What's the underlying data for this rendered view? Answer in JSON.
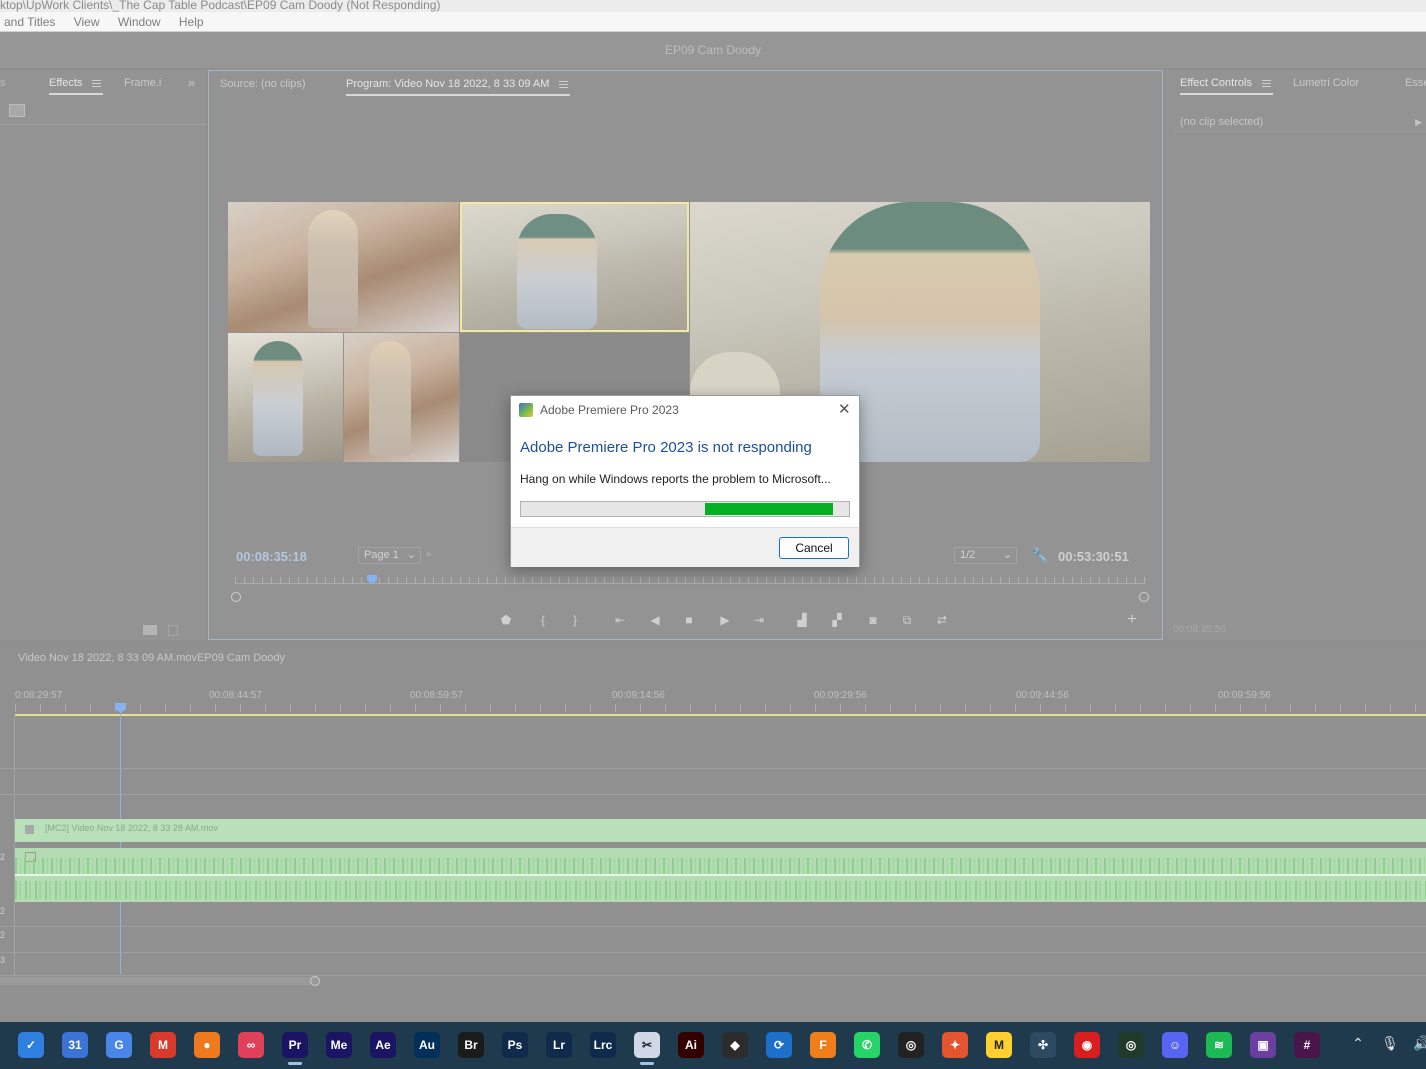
{
  "window": {
    "path_title": "ktop\\UpWork Clients\\_The Cap Table Podcast\\EP09 Cam Doody (Not Responding)",
    "menu": [
      "and Titles",
      "View",
      "Window",
      "Help"
    ],
    "workspace_title": "EP09 Cam Doody"
  },
  "left_panel": {
    "tabs": [
      "Effects",
      "Frame.i"
    ],
    "overflow_icon": "chevron-double-right-icon"
  },
  "monitor": {
    "source_tab": "Source: (no clips)",
    "program_tab": "Program: Video Nov 18 2022, 8 33 09 AM",
    "current_time": "00:08:35:18",
    "page_select": "Page 1",
    "resolution": "1/2",
    "duration": "00:53:30:51",
    "playhead_position": 0.15
  },
  "effect_controls": {
    "tabs": [
      "Effect Controls",
      "Lumetri Color",
      "Esse"
    ],
    "no_clip": "(no clip selected)",
    "time": "00:08:35:56"
  },
  "timeline": {
    "sequence_name": "Video Nov 18 2022, 8 33 09 AM.movEP09 Cam Doody",
    "ruler": [
      "0:08:29:57",
      "00:08:44:57",
      "00:08:59:57",
      "00:09:14:56",
      "00:09:29:56",
      "00:09:44:56",
      "00:09:59:56"
    ],
    "clip_name": "[MC2] Video Nov 18 2022, 8 33 28 AM.mov",
    "track_labels": [
      "2",
      "2",
      "2",
      "3"
    ]
  },
  "dialog": {
    "title": "Adobe Premiere Pro 2023",
    "heading": "Adobe Premiere Pro 2023 is not responding",
    "message": "Hang on while Windows reports the problem to Microsoft...",
    "progress_start": 0.56,
    "progress_end": 0.95,
    "cancel_label": "Cancel"
  },
  "taskbar": {
    "apps": [
      {
        "name": "todo-icon",
        "label": "✓",
        "color": "#2f7fe0"
      },
      {
        "name": "calendar-icon",
        "label": "31",
        "color": "#3b74d6"
      },
      {
        "name": "translate-icon",
        "label": "G",
        "color": "#4a86e8"
      },
      {
        "name": "gmail-icon",
        "label": "M",
        "color": "#d93a2b"
      },
      {
        "name": "firefox-icon",
        "label": "●",
        "color": "#ef7a1e"
      },
      {
        "name": "creative-cloud-icon",
        "label": "∞",
        "color": "#e0405a"
      },
      {
        "name": "premiere-icon",
        "label": "Pr",
        "color": "#1a1463"
      },
      {
        "name": "media-encoder-icon",
        "label": "Me",
        "color": "#1a1463"
      },
      {
        "name": "after-effects-icon",
        "label": "Ae",
        "color": "#1a1463"
      },
      {
        "name": "audition-icon",
        "label": "Au",
        "color": "#00305a"
      },
      {
        "name": "bridge-icon",
        "label": "Br",
        "color": "#1b1b1b"
      },
      {
        "name": "photoshop-icon",
        "label": "Ps",
        "color": "#0f2a4a"
      },
      {
        "name": "lightroom-icon",
        "label": "Lr",
        "color": "#0f2a4a"
      },
      {
        "name": "lightroom-classic-icon",
        "label": "Lrc",
        "color": "#0f2a4a"
      },
      {
        "name": "snipping-tool-icon",
        "label": "✂",
        "color": "#cfd8e4"
      },
      {
        "name": "illustrator-icon",
        "label": "Ai",
        "color": "#330000"
      },
      {
        "name": "davinci-icon",
        "label": "◆",
        "color": "#2c2c2c"
      },
      {
        "name": "sync-icon",
        "label": "⟳",
        "color": "#1d6fc9"
      },
      {
        "name": "fl-studio-icon",
        "label": "F",
        "color": "#f07f1b"
      },
      {
        "name": "whatsapp-icon",
        "label": "✆",
        "color": "#25d366"
      },
      {
        "name": "obs-icon",
        "label": "◎",
        "color": "#222222"
      },
      {
        "name": "tool-icon",
        "label": "✦",
        "color": "#e4552f"
      },
      {
        "name": "miro-icon",
        "label": "M",
        "color": "#ffd02f"
      },
      {
        "name": "grid-app-icon",
        "label": "✣",
        "color": "#2d4a63"
      },
      {
        "name": "recorder-icon",
        "label": "◉",
        "color": "#d81e1e"
      },
      {
        "name": "network-icon",
        "label": "◎",
        "color": "#203a2a"
      },
      {
        "name": "discord-icon",
        "label": "☺",
        "color": "#5865f2"
      },
      {
        "name": "spotify-icon",
        "label": "≋",
        "color": "#1db954"
      },
      {
        "name": "screen-app-icon",
        "label": "▣",
        "color": "#6b3fa0"
      },
      {
        "name": "slack-icon",
        "label": "#",
        "color": "#4a154b"
      }
    ],
    "tray": [
      "chevron-up-icon",
      "microphone-icon",
      "volume-icon"
    ]
  }
}
